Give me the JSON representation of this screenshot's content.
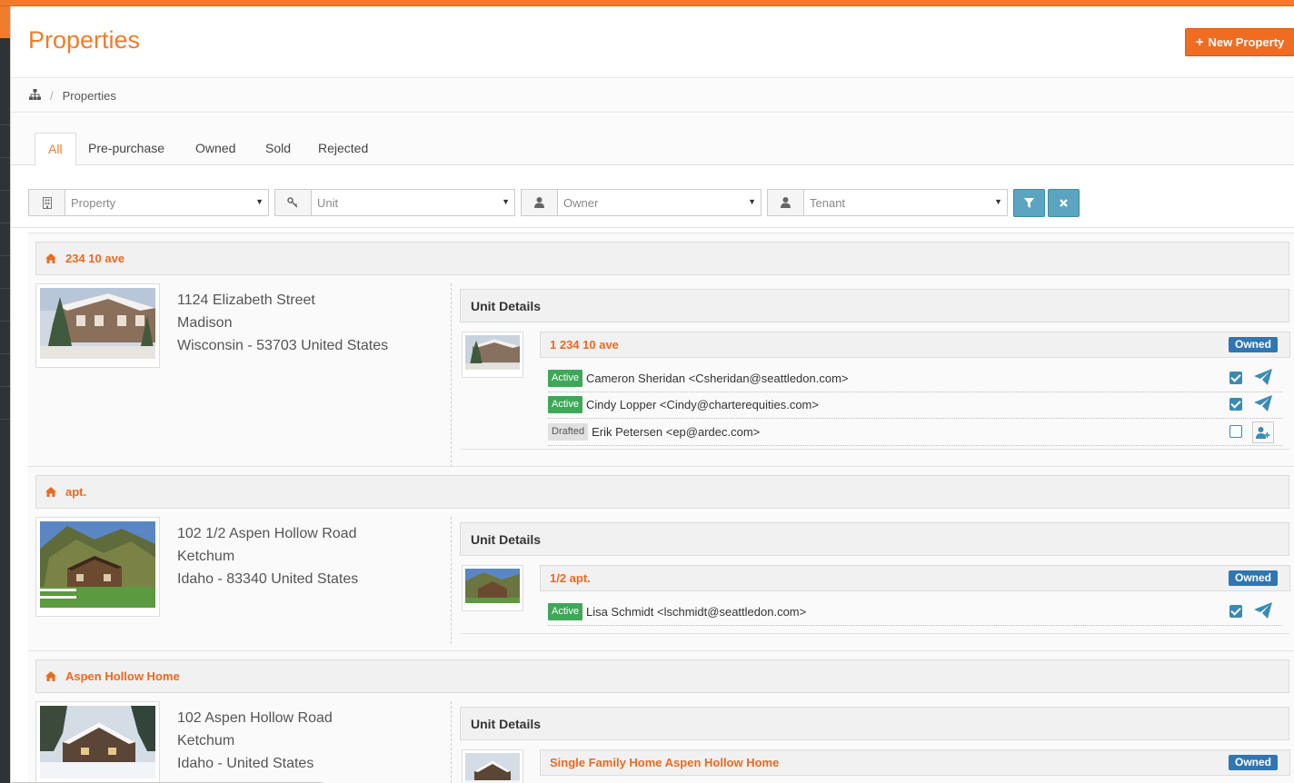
{
  "page": {
    "title": "Properties",
    "new_button_label": "New Property"
  },
  "breadcrumb": {
    "home_icon": "sitemap-icon",
    "current": "Properties"
  },
  "tabs": [
    {
      "label": "All",
      "active": true
    },
    {
      "label": "Pre-purchase",
      "active": false
    },
    {
      "label": "Owned",
      "active": false
    },
    {
      "label": "Sold",
      "active": false
    },
    {
      "label": "Rejected",
      "active": false
    }
  ],
  "filters": {
    "property": {
      "icon": "building-icon",
      "placeholder": "Property"
    },
    "unit": {
      "icon": "key-icon",
      "placeholder": "Unit"
    },
    "owner": {
      "icon": "user-icon",
      "placeholder": "Owner"
    },
    "tenant": {
      "icon": "user-icon",
      "placeholder": "Tenant"
    },
    "apply_icon": "filter-icon",
    "clear_icon": "times-icon"
  },
  "properties": [
    {
      "name": "234 10 ave",
      "address_line1": "1124 Elizabeth Street",
      "address_line2": "Madison",
      "address_line3": "Wisconsin - 53703 United States",
      "unit_section_title": "Unit Details",
      "unit": {
        "name": "1 234 10 ave",
        "status": "Owned",
        "tenants": [
          {
            "status": "Active",
            "text": "Cameron Sheridan <Csheridan@seattledon.com>",
            "checked": true,
            "action": "send-icon"
          },
          {
            "status": "Active",
            "text": "Cindy Lopper <Cindy@charterequities.com>",
            "checked": true,
            "action": "send-icon"
          },
          {
            "status": "Drafted",
            "text": "Erik Petersen <ep@ardec.com>",
            "checked": false,
            "action": "add-user-icon"
          }
        ]
      }
    },
    {
      "name": "apt.",
      "address_line1": "102 1/2 Aspen Hollow Road",
      "address_line2": "Ketchum",
      "address_line3": "Idaho - 83340 United States",
      "unit_section_title": "Unit Details",
      "unit": {
        "name": "1/2 apt.",
        "status": "Owned",
        "tenants": [
          {
            "status": "Active",
            "text": "Lisa Schmidt <lschmidt@seattledon.com>",
            "checked": true,
            "action": "send-icon"
          }
        ]
      }
    },
    {
      "name": "Aspen Hollow Home",
      "address_line1": "102 Aspen Hollow Road",
      "address_line2": "Ketchum",
      "address_line3": "Idaho - United States",
      "unit_section_title": "Unit Details",
      "unit": {
        "name": "Single Family Home Aspen Hollow Home",
        "status": "Owned",
        "tenants": []
      }
    }
  ],
  "colors": {
    "brand": "#f07c2c",
    "owned_badge": "#2f76b2",
    "active_badge": "#3ea858",
    "filter_button": "#5ba5c0"
  }
}
